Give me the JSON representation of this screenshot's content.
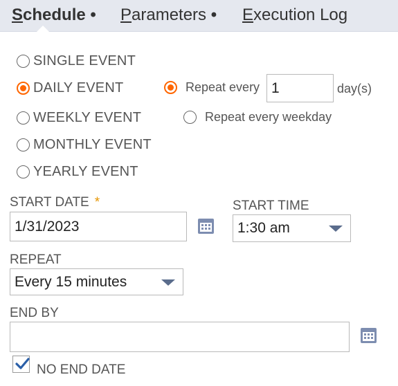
{
  "tabs": [
    {
      "underline": "S",
      "rest": "chedule",
      "dot": "•",
      "active": true
    },
    {
      "underline": "P",
      "rest": "arameters",
      "dot": "•",
      "active": false
    },
    {
      "underline": "E",
      "rest": "xecution Log",
      "dot": "",
      "active": false
    }
  ],
  "frequency": {
    "options": [
      {
        "label": "SINGLE EVENT",
        "checked": false
      },
      {
        "label": "DAILY EVENT",
        "checked": true
      },
      {
        "label": "WEEKLY EVENT",
        "checked": false
      },
      {
        "label": "MONTHLY EVENT",
        "checked": false
      },
      {
        "label": "YEARLY EVENT",
        "checked": false
      }
    ]
  },
  "daily": {
    "repeat_every_label": "Repeat every",
    "repeat_every_value": "1",
    "unit": "day(s)",
    "weekday_label": "Repeat every weekday",
    "repeat_every_checked": true,
    "weekday_checked": false
  },
  "start_date": {
    "label": "START DATE",
    "required_marker": "*",
    "value": "1/31/2023"
  },
  "start_time": {
    "label": "START TIME",
    "value": "1:30 am"
  },
  "repeat": {
    "label": "REPEAT",
    "value": "Every 15 minutes"
  },
  "end_by": {
    "label": "END BY",
    "value": ""
  },
  "no_end_date": {
    "label": "NO END DATE",
    "checked": true
  },
  "colors": {
    "accent": "#ff6600",
    "tab_bar": "#e5e8ef",
    "icon": "#7d8db0",
    "required": "#e69500",
    "check": "#2a5fa8"
  }
}
